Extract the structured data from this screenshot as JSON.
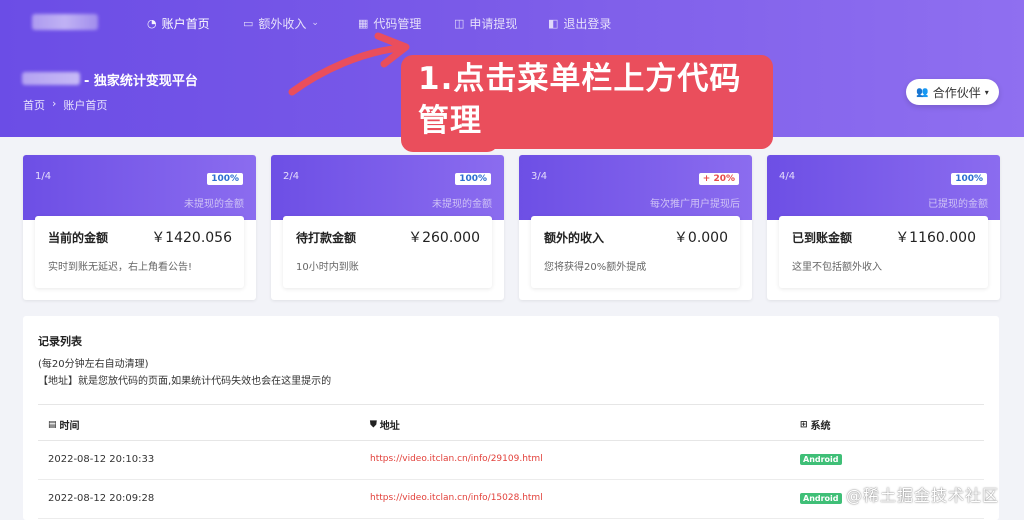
{
  "nav": {
    "items": [
      {
        "icon": "dashboard-icon",
        "glyph": "◔",
        "label": "账户首页"
      },
      {
        "icon": "wallet-icon",
        "glyph": "▭",
        "label": "额外收入"
      },
      {
        "icon": "grid-icon",
        "glyph": "▦",
        "label": "代码管理"
      },
      {
        "icon": "money-icon",
        "glyph": "◫",
        "label": "申请提现"
      },
      {
        "icon": "logout-icon",
        "glyph": "◧",
        "label": "退出登录"
      }
    ],
    "dropdown_caret": "⌄"
  },
  "header": {
    "site_title": "- 独家统计变现平台",
    "breadcrumb": {
      "home": "首页",
      "separator": "›",
      "current": "账户首页"
    },
    "partner_button": "合作伙伴",
    "partner_icon": "users-icon",
    "partner_glyph": "👥",
    "partner_caret": "▾"
  },
  "annotation": {
    "text": "1.点击菜单栏上方代码管理",
    "color": "#ea4e5c"
  },
  "cards": [
    {
      "index": "1/4",
      "badge": "100%",
      "badge_color": "blue",
      "subtitle": "未提现的金额",
      "label": "当前的金额",
      "amount": "￥1420.056",
      "note": "实时到账无延迟，右上角看公告!"
    },
    {
      "index": "2/4",
      "badge": "100%",
      "badge_color": "blue",
      "subtitle": "未提现的金额",
      "label": "待打款金额",
      "amount": "￥260.000",
      "note": "10小时内到账"
    },
    {
      "index": "3/4",
      "badge": "+ 20%",
      "badge_color": "red",
      "subtitle": "每次推广用户提现后",
      "label": "额外的收入",
      "amount": "￥0.000",
      "note": "您将获得20%额外提成"
    },
    {
      "index": "4/4",
      "badge": "100%",
      "badge_color": "blue",
      "subtitle": "已提现的金额",
      "label": "已到账金额",
      "amount": "￥1160.000",
      "note": "这里不包括额外收入"
    }
  ],
  "records": {
    "title": "记录列表",
    "line1": "(每20分钟左右自动清理)",
    "line2": "【地址】就是您放代码的页面,如果统计代码失效也会在这里提示的",
    "columns": [
      {
        "icon": "calendar-icon",
        "glyph": "▤",
        "label": "时间"
      },
      {
        "icon": "shield-icon",
        "glyph": "⛊",
        "label": "地址"
      },
      {
        "icon": "windows-icon",
        "glyph": "⊞",
        "label": "系统"
      }
    ],
    "rows": [
      {
        "time": "2022-08-12 20:10:33",
        "url": "https://video.itclan.cn/info/29109.html",
        "os": "Android"
      },
      {
        "time": "2022-08-12 20:09:28",
        "url": "https://video.itclan.cn/info/15028.html",
        "os": "Android"
      }
    ]
  },
  "watermark": "@稀土掘金技术社区",
  "colors": {
    "brand_purple": "#7052e7",
    "callout_red": "#ea4e5c",
    "android_green": "#3fbf77",
    "url_red": "#e2413b"
  }
}
